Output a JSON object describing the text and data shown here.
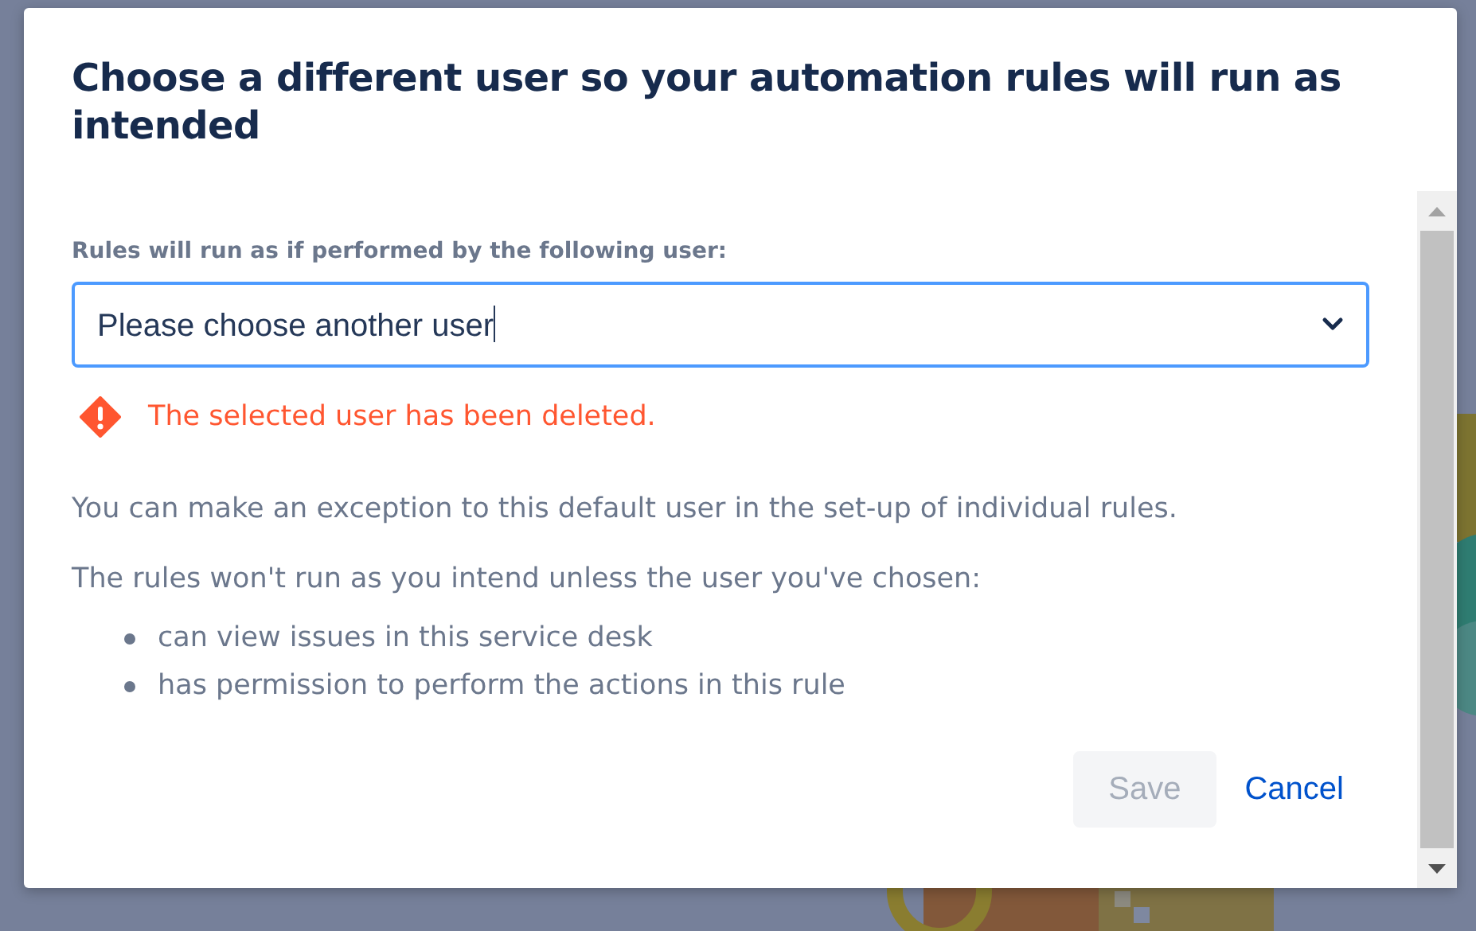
{
  "dialog": {
    "title": "Choose a different user so your automation rules will run as intended",
    "field_label": "Rules will run as if performed by the following user:",
    "user_select": {
      "value": "Please choose another user",
      "focused": true
    },
    "error": "The selected user has been deleted.",
    "paragraphs": [
      "You can make an exception to this default user in the set-up of individual rules.",
      "The rules won't run as you intend unless the user you've chosen:"
    ],
    "bullets": [
      "can view issues in this service desk",
      "has permission to perform the actions in this rule"
    ],
    "buttons": [
      {
        "label": "Save",
        "kind": "primary",
        "disabled": true
      },
      {
        "label": "Cancel",
        "kind": "link",
        "disabled": false
      }
    ]
  }
}
